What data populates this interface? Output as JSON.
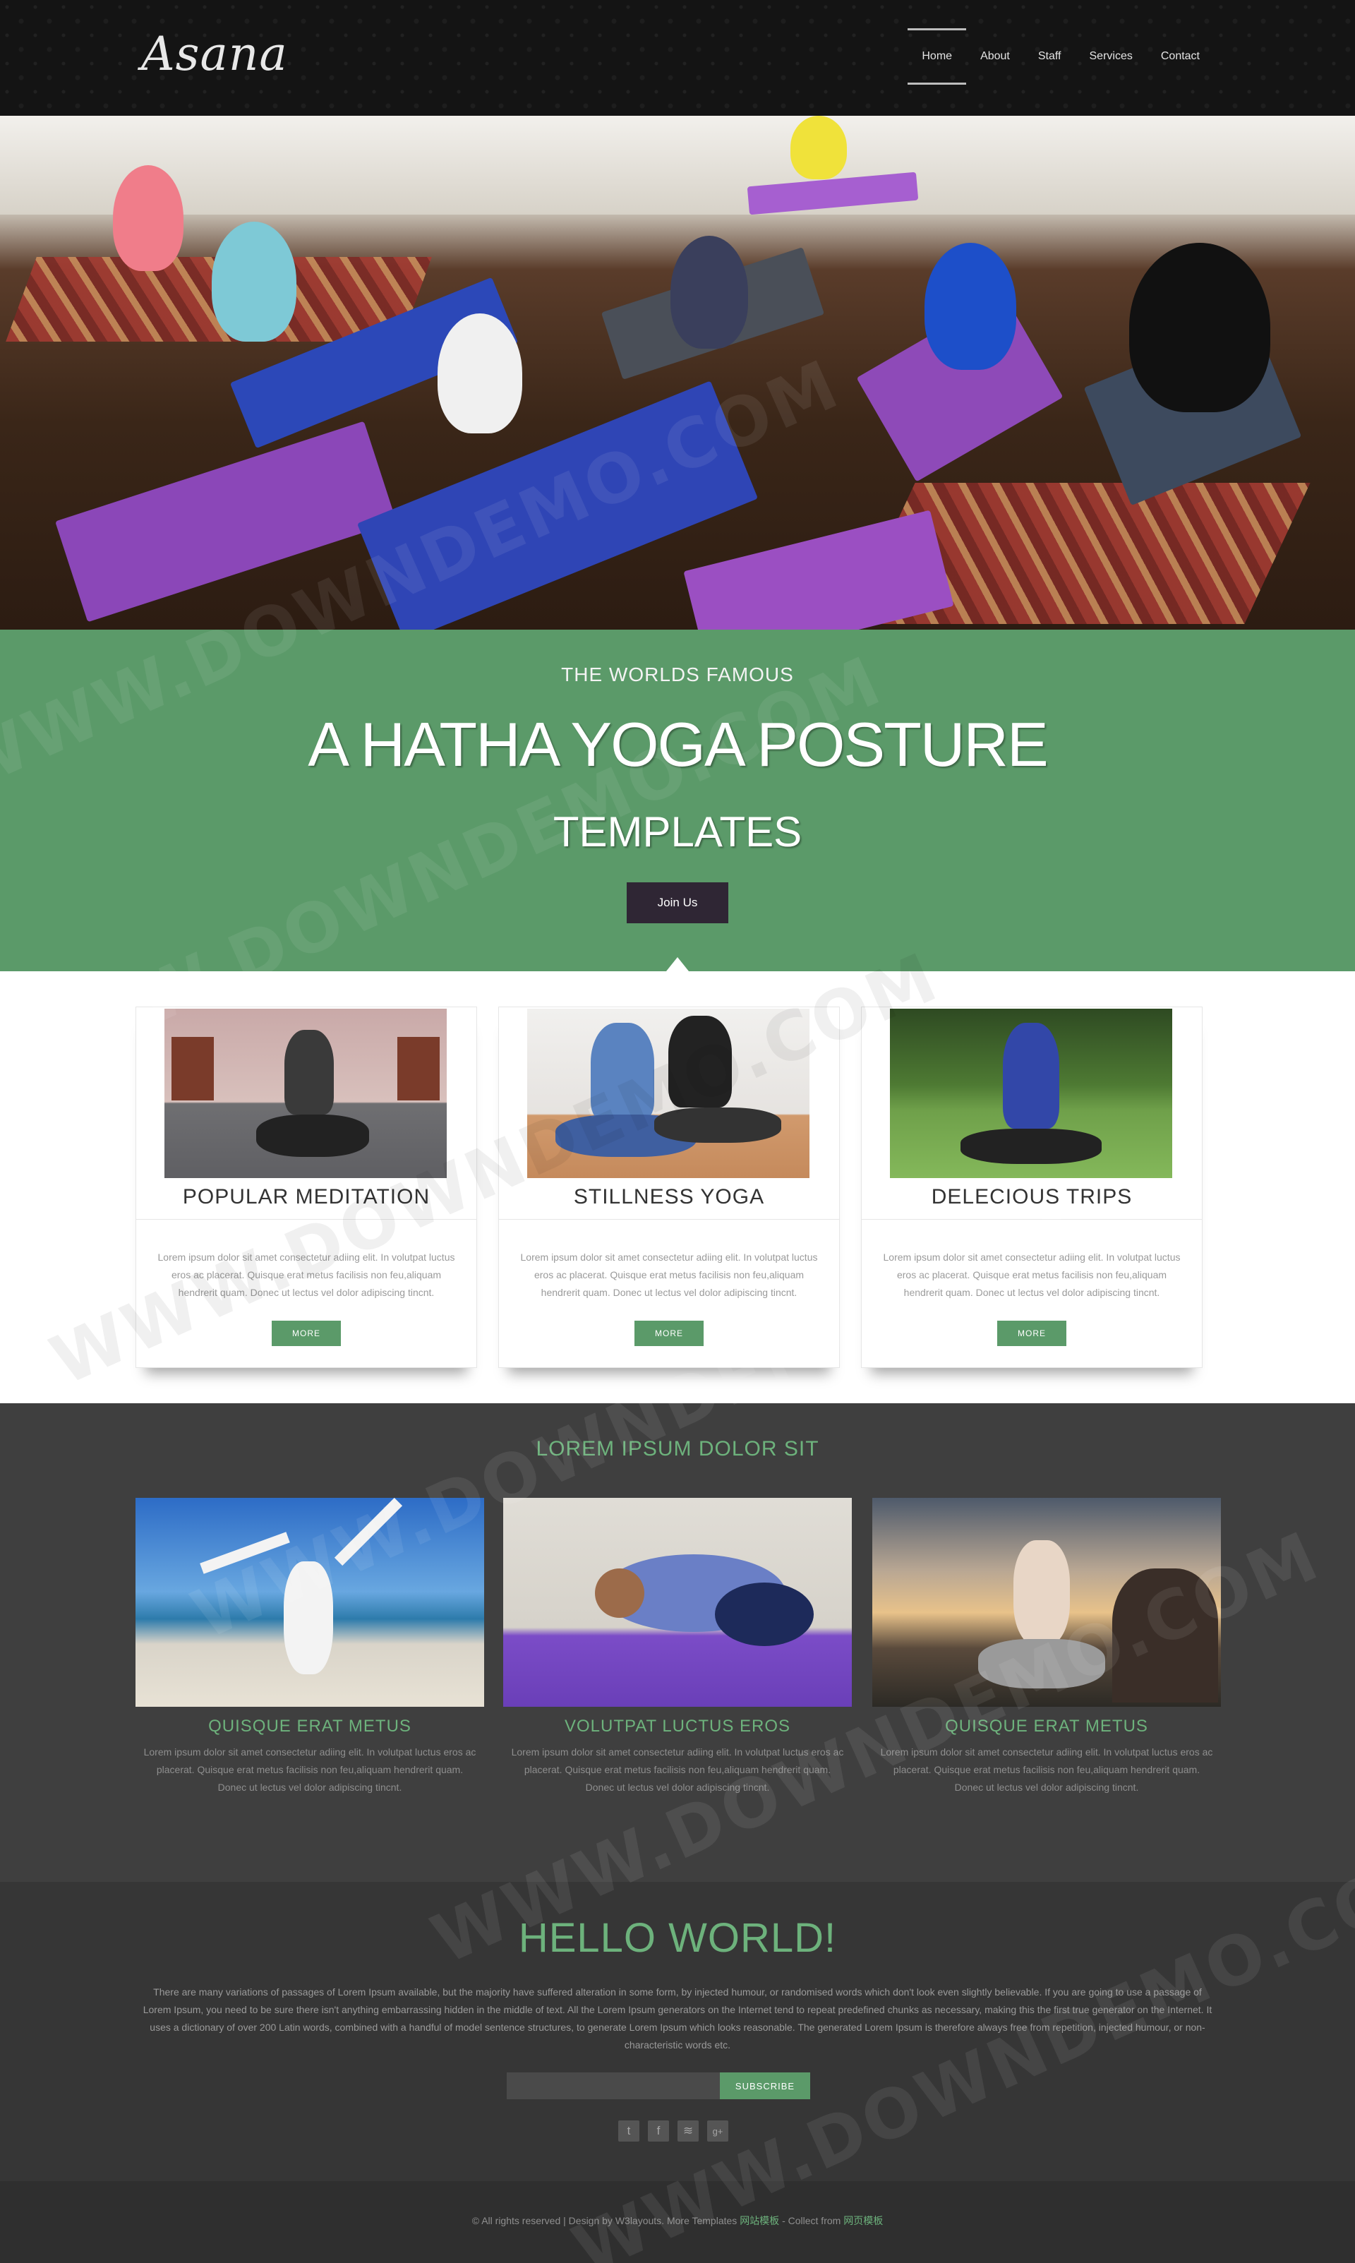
{
  "header": {
    "logo": "Asana",
    "nav": [
      {
        "label": "Home",
        "active": true
      },
      {
        "label": "About",
        "active": false
      },
      {
        "label": "Staff",
        "active": false
      },
      {
        "label": "Services",
        "active": false
      },
      {
        "label": "Contact",
        "active": false
      }
    ]
  },
  "banner": {
    "kicker": "THE WORLDS FAMOUS",
    "title": "A HATHA YOGA POSTURE",
    "subtitle": "TEMPLATES",
    "button": "Join Us"
  },
  "features": [
    {
      "title": "POPULAR MEDITATION",
      "text": "Lorem ipsum dolor sit amet consectetur adiing elit. In volutpat luctus eros ac placerat. Quisque erat metus facilisis non feu,aliquam hendrerit quam. Donec ut lectus vel dolor adipiscing tincnt.",
      "button": "MORE"
    },
    {
      "title": "STILLNESS YOGA",
      "text": "Lorem ipsum dolor sit amet consectetur adiing elit. In volutpat luctus eros ac placerat. Quisque erat metus facilisis non feu,aliquam hendrerit quam. Donec ut lectus vel dolor adipiscing tincnt.",
      "button": "MORE"
    },
    {
      "title": "DELECIOUS TRIPS",
      "text": "Lorem ipsum dolor sit amet consectetur adiing elit. In volutpat luctus eros ac placerat. Quisque erat metus facilisis non feu,aliquam hendrerit quam. Donec ut lectus vel dolor adipiscing tincnt.",
      "button": "MORE"
    }
  ],
  "gallery": {
    "heading": "LOREM IPSUM DOLOR SIT",
    "tiles": [
      {
        "title": "QUISQUE ERAT METUS",
        "text": "Lorem ipsum dolor sit amet consectetur adiing elit. In volutpat luctus eros ac placerat. Quisque erat metus facilisis non feu,aliquam hendrerit quam. Donec ut lectus vel dolor adipiscing tincnt."
      },
      {
        "title": "VOLUTPAT LUCTUS EROS",
        "text": "Lorem ipsum dolor sit amet consectetur adiing elit. In volutpat luctus eros ac placerat. Quisque erat metus facilisis non feu,aliquam hendrerit quam. Donec ut lectus vel dolor adipiscing tincnt."
      },
      {
        "title": "QUISQUE ERAT METUS",
        "text": "Lorem ipsum dolor sit amet consectetur adiing elit. In volutpat luctus eros ac placerat. Quisque erat metus facilisis non feu,aliquam hendrerit quam. Donec ut lectus vel dolor adipiscing tincnt."
      }
    ]
  },
  "hello": {
    "title": "HELLO WORLD!",
    "text": "There are many variations of passages of Lorem Ipsum available, but the majority have suffered alteration in some form, by injected humour, or randomised words which don't look even slightly believable. If you are going to use a passage of Lorem Ipsum, you need to be sure there isn't anything embarrassing hidden in the middle of text. All the Lorem Ipsum generators on the Internet tend to repeat predefined chunks as necessary, making this the first true generator on the Internet. It uses a dictionary of over 200 Latin words, combined with a handful of model sentence structures, to generate Lorem Ipsum which looks reasonable. The generated Lorem Ipsum is therefore always free from repetition, injected humour, or non-characteristic words etc.",
    "subscribe_placeholder": "",
    "subscribe_button": "SUBSCRIBE",
    "social": [
      {
        "icon": "twitter-icon",
        "glyph": "t"
      },
      {
        "icon": "facebook-icon",
        "glyph": "f"
      },
      {
        "icon": "rss-icon",
        "glyph": "≋"
      },
      {
        "icon": "googleplus-icon",
        "glyph": "g+"
      }
    ]
  },
  "footer": {
    "text": "© All rights reserved | Design by W3layouts. More Templates ",
    "link1": "网站模板",
    "middle": " - Collect from ",
    "link2": "网页模板"
  },
  "watermark": "WWW.DOWNDEMO.COM",
  "colors": {
    "accent": "#5b9a69",
    "accent_text": "#6db27c",
    "dark_button": "#2f2634"
  }
}
